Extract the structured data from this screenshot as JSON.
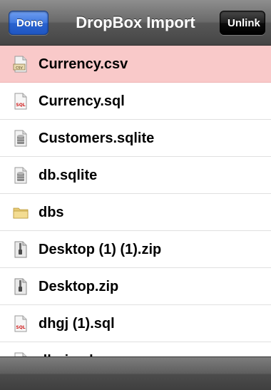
{
  "navbar": {
    "title": "DropBox Import",
    "done_label": "Done",
    "unlink_label": "Unlink"
  },
  "files": [
    {
      "name": "Currency.csv",
      "icon": "csv-file-icon",
      "selected": true
    },
    {
      "name": "Currency.sql",
      "icon": "sql-file-icon",
      "selected": false
    },
    {
      "name": "Customers.sqlite",
      "icon": "database-file-icon",
      "selected": false
    },
    {
      "name": "db.sqlite",
      "icon": "database-file-icon",
      "selected": false
    },
    {
      "name": "dbs",
      "icon": "folder-icon",
      "selected": false
    },
    {
      "name": "Desktop (1) (1).zip",
      "icon": "zip-file-icon",
      "selected": false
    },
    {
      "name": "Desktop.zip",
      "icon": "zip-file-icon",
      "selected": false
    },
    {
      "name": "dhgj (1).sql",
      "icon": "sql-file-icon",
      "selected": false
    },
    {
      "name": "dhgj.sql",
      "icon": "sql-file-icon",
      "selected": false
    }
  ],
  "colors": {
    "selected_row": "#f9c9c9",
    "done_button": "#3f78df",
    "navbar": "#6a6a6a"
  }
}
